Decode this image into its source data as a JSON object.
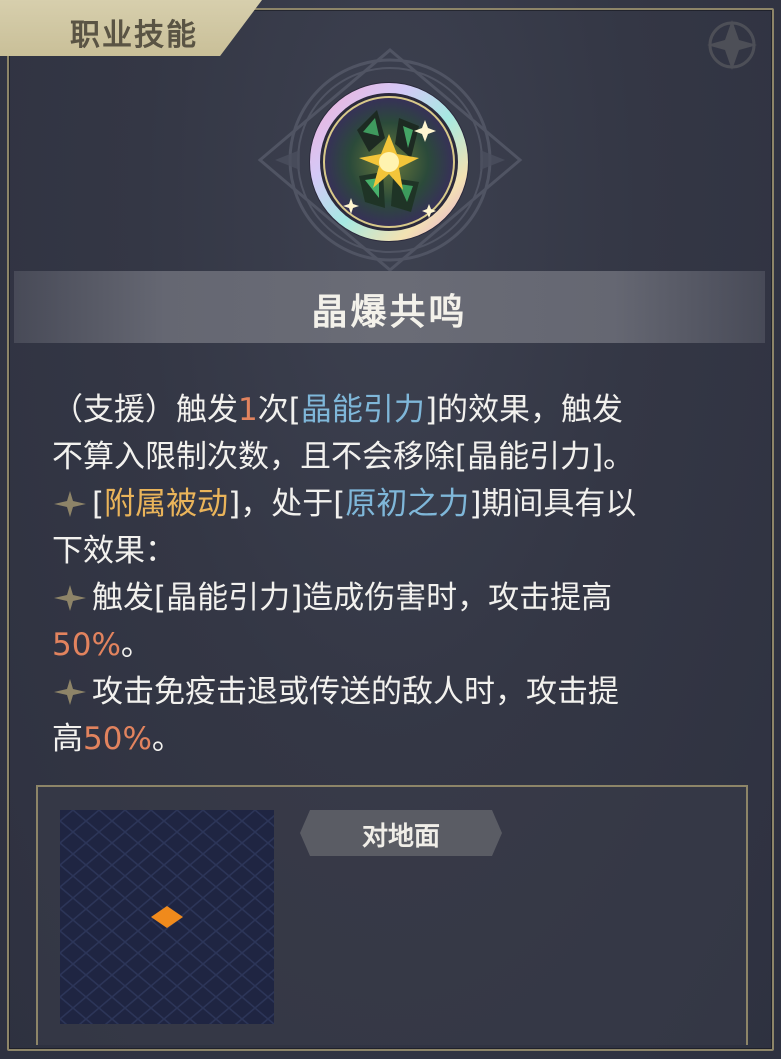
{
  "header": {
    "tab_label": "职业技能"
  },
  "skill": {
    "icon": "crystal-burst-icon",
    "name": "晶爆共鸣"
  },
  "description": {
    "line1": {
      "a": "（支援）触发",
      "num": "1",
      "b": "次[",
      "kw": "晶能引力",
      "c": "]的效果，触发"
    },
    "line2": "不算入限制次数，且不会移除[晶能引力]。",
    "passive": {
      "open": "[",
      "kw1": "附属被动",
      "mid": "]，处于[",
      "kw2": "原初之力",
      "end": "]期间具有以"
    },
    "passive_cont": "下效果：",
    "effect1": {
      "text": "触发[晶能引力]造成伤害时，攻击提高",
      "value": "50%",
      "end": "。"
    },
    "effect2": {
      "text": "攻击免疫击退或传送的敌人时，攻击提",
      "cont": "高",
      "value": "50%",
      "end": "。"
    }
  },
  "range": {
    "tag_label": "对地面"
  },
  "colors": {
    "accent_number": "#e2835e",
    "keyword_blue": "#7fb7d9",
    "keyword_gold": "#eab45a",
    "frame_gold": "#8d8568",
    "range_marker": "#f08a1c"
  }
}
